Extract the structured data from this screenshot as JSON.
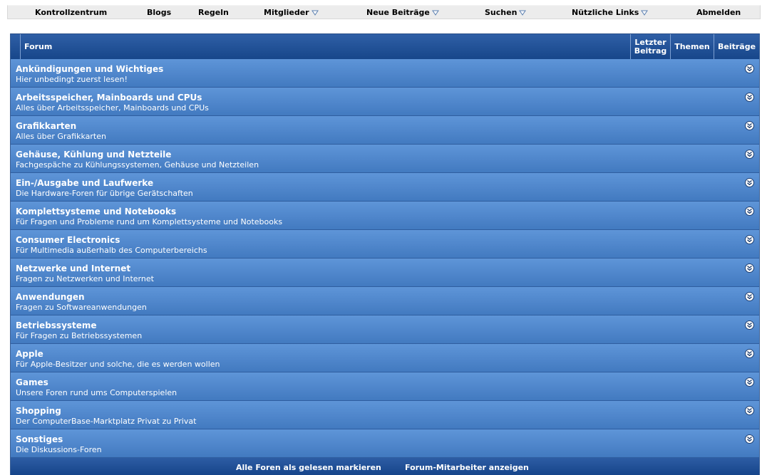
{
  "navbar": {
    "items": [
      {
        "label": "Kontrollzentrum",
        "dropdown": false
      },
      {
        "label": "Blogs",
        "dropdown": false
      },
      {
        "label": "Regeln",
        "dropdown": false
      },
      {
        "label": "Mitglieder",
        "dropdown": true
      },
      {
        "label": "Neue Beiträge",
        "dropdown": true
      },
      {
        "label": "Suchen",
        "dropdown": true
      },
      {
        "label": "Nützliche Links",
        "dropdown": true
      },
      {
        "label": "Abmelden",
        "dropdown": false
      }
    ]
  },
  "table": {
    "headers": {
      "forum": "Forum",
      "last_post_line1": "Letzter",
      "last_post_line2": "Beitrag",
      "threads": "Themen",
      "posts": "Beiträge"
    },
    "rows": [
      {
        "title": "Ankündigungen und Wichtiges",
        "description": "Hier unbedingt zuerst lesen!"
      },
      {
        "title": "Arbeitsspeicher, Mainboards und CPUs",
        "description": "Alles über Arbeitsspeicher, Mainboards und CPUs"
      },
      {
        "title": "Grafikkarten",
        "description": "Alles über Grafikkarten"
      },
      {
        "title": "Gehäuse, Kühlung und Netzteile",
        "description": "Fachgespäche zu Kühlungssystemen, Gehäuse und Netzteilen"
      },
      {
        "title": "Ein-/Ausgabe und Laufwerke",
        "description": "Die Hardware-Foren für übrige Gerätschaften"
      },
      {
        "title": "Komplettsysteme und Notebooks",
        "description": "Für Fragen und Probleme rund um Komplettsysteme und Notebooks"
      },
      {
        "title": "Consumer Electronics",
        "description": "Für Multimedia außerhalb des Computerbereichs"
      },
      {
        "title": "Netzwerke und Internet",
        "description": "Fragen zu Netzwerken und Internet"
      },
      {
        "title": "Anwendungen",
        "description": "Fragen zu Softwareanwendungen"
      },
      {
        "title": "Betriebssysteme",
        "description": "Für Fragen zu Betriebssystemen"
      },
      {
        "title": "Apple",
        "description": "Für Apple-Besitzer und solche, die es werden wollen"
      },
      {
        "title": "Games",
        "description": "Unsere Foren rund ums Computerspielen"
      },
      {
        "title": "Shopping",
        "description": "Der ComputerBase-Marktplatz Privat zu Privat"
      },
      {
        "title": "Sonstiges",
        "description": "Die Diskussions-Foren"
      }
    ],
    "footer": {
      "mark_read": "Alle Foren als gelesen markieren",
      "show_staff": "Forum-Mitarbeiter anzeigen"
    }
  },
  "icons": {
    "collapse": "collapse-icon",
    "dropdown": "triangle-down-icon"
  },
  "colors": {
    "row_blue": "#4f86cb",
    "header_blue": "#17468a",
    "navbar_bg": "#ececec"
  }
}
